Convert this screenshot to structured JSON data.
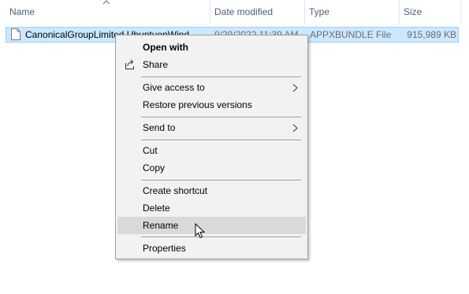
{
  "columns": {
    "name": "Name",
    "date_modified": "Date modified",
    "type": "Type",
    "size": "Size"
  },
  "file": {
    "name": "CanonicalGroupLimited.UbuntuonWind...",
    "date_modified": "9/29/2022 11:39 AM",
    "type": "APPXBUNDLE File",
    "size": "915,989 KB",
    "icon": "file-icon"
  },
  "context_menu": {
    "open_with": "Open with",
    "share": "Share",
    "give_access_to": "Give access to",
    "restore_previous_versions": "Restore previous versions",
    "send_to": "Send to",
    "cut": "Cut",
    "copy": "Copy",
    "create_shortcut": "Create shortcut",
    "delete": "Delete",
    "rename": "Rename",
    "properties": "Properties",
    "hovered_item": "Rename"
  },
  "colors": {
    "selection_bg": "#cce8ff",
    "selection_border": "#99d1ff",
    "menu_bg": "#f2f2f2",
    "menu_hover": "#d9d9d9",
    "header_text": "#4c607a"
  }
}
